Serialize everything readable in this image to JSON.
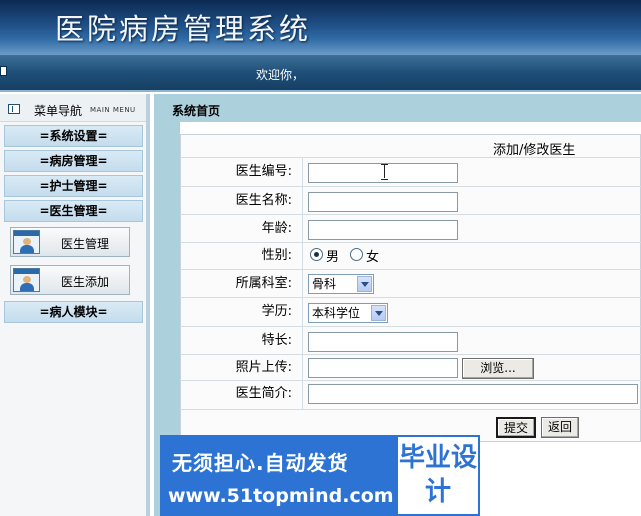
{
  "header": {
    "title": "医院病房管理系统",
    "welcome": "欢迎你，"
  },
  "sidebar": {
    "title": "菜单导航",
    "title_en": "MAIN MENU",
    "categories": [
      "=系统设置=",
      "=病房管理=",
      "=护士管理=",
      "=医生管理=",
      "=病人模块="
    ],
    "doctor_items": [
      "医生管理",
      "医生添加"
    ]
  },
  "main": {
    "breadcrumb": "系统首页",
    "form_title": "添加/修改医生",
    "fields": {
      "doctor_id": {
        "label": "医生编号:",
        "value": ""
      },
      "doctor_name": {
        "label": "医生名称:",
        "value": ""
      },
      "age": {
        "label": "年龄:",
        "value": ""
      },
      "gender": {
        "label": "性别:",
        "options": [
          "男",
          "女"
        ],
        "selected": "男"
      },
      "department": {
        "label": "所属科室:",
        "value": "骨科"
      },
      "education": {
        "label": "学历:",
        "value": "本科学位"
      },
      "specialty": {
        "label": "特长:",
        "value": ""
      },
      "photo": {
        "label": "照片上传:",
        "value": "",
        "browse_label": "浏览..."
      },
      "intro": {
        "label": "医生简介:",
        "value": ""
      }
    },
    "submit_label": "提交",
    "back_label": "返回"
  },
  "watermark": {
    "slogan": "无须担心.自动发货",
    "url": "www.51topmind.com",
    "badge": "毕业设计"
  },
  "colors": {
    "banner": "#1f4f86",
    "nav_bar": "#1e4f78",
    "menu_category": "#c4dced",
    "breadcrumb_bar": "#acd1dd",
    "watermark_blue": "#2d73d4"
  }
}
